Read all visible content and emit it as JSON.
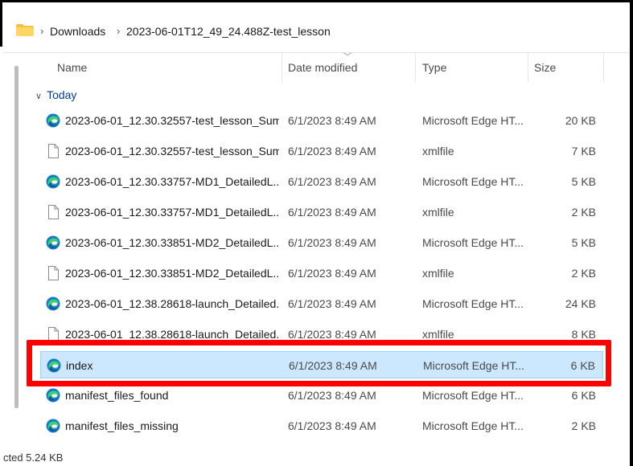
{
  "breadcrumb": {
    "items": [
      "Downloads",
      "2023-06-01T12_49_24.488Z-test_lesson"
    ]
  },
  "columns": {
    "name": "Name",
    "date": "Date modified",
    "type": "Type",
    "size": "Size"
  },
  "group": {
    "label": "Today"
  },
  "files": [
    {
      "name": "2023-06-01_12.30.32557-test_lesson_Sum...",
      "date": "6/1/2023 8:49 AM",
      "type": "Microsoft Edge HT...",
      "size": "20 KB",
      "icon": "edge-icon"
    },
    {
      "name": "2023-06-01_12.30.32557-test_lesson_Sum...",
      "date": "6/1/2023 8:49 AM",
      "type": "xmlfile",
      "size": "7 KB",
      "icon": "file-icon"
    },
    {
      "name": "2023-06-01_12.30.33757-MD1_DetailedL...",
      "date": "6/1/2023 8:49 AM",
      "type": "Microsoft Edge HT...",
      "size": "5 KB",
      "icon": "edge-icon"
    },
    {
      "name": "2023-06-01_12.30.33757-MD1_DetailedL...",
      "date": "6/1/2023 8:49 AM",
      "type": "xmlfile",
      "size": "2 KB",
      "icon": "file-icon"
    },
    {
      "name": "2023-06-01_12.30.33851-MD2_DetailedL...",
      "date": "6/1/2023 8:49 AM",
      "type": "Microsoft Edge HT...",
      "size": "5 KB",
      "icon": "edge-icon"
    },
    {
      "name": "2023-06-01_12.30.33851-MD2_DetailedL...",
      "date": "6/1/2023 8:49 AM",
      "type": "xmlfile",
      "size": "2 KB",
      "icon": "file-icon"
    },
    {
      "name": "2023-06-01_12.38.28618-launch_Detailed...",
      "date": "6/1/2023 8:49 AM",
      "type": "Microsoft Edge HT...",
      "size": "24 KB",
      "icon": "edge-icon"
    },
    {
      "name": "2023-06-01_12.38.28618-launch_Detailed...",
      "date": "6/1/2023 8:49 AM",
      "type": "xmlfile",
      "size": "8 KB",
      "icon": "file-icon"
    },
    {
      "name": "index",
      "date": "6/1/2023 8:49 AM",
      "type": "Microsoft Edge HT...",
      "size": "6 KB",
      "icon": "edge-icon",
      "selected": true
    },
    {
      "name": "manifest_files_found",
      "date": "6/1/2023 8:49 AM",
      "type": "Microsoft Edge HT...",
      "size": "6 KB",
      "icon": "edge-icon"
    },
    {
      "name": "manifest_files_missing",
      "date": "6/1/2023 8:49 AM",
      "type": "Microsoft Edge HT...",
      "size": "2 KB",
      "icon": "edge-icon"
    }
  ],
  "status": {
    "text": "cted  5.24 KB"
  },
  "colors": {
    "selection": "#cce8ff",
    "highlight": "#ff0000",
    "folder": "#f5c242"
  }
}
